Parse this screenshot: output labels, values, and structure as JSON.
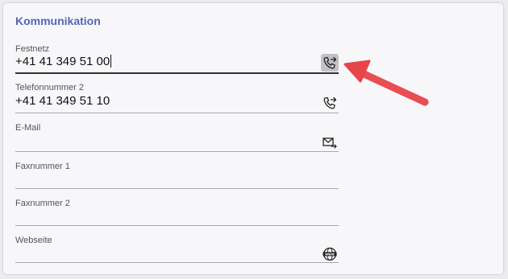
{
  "section": {
    "title": "Kommunikation"
  },
  "fields": {
    "festnetz": {
      "label": "Festnetz",
      "value": "+41 41 349 51 00",
      "icon": "phone-forward-icon"
    },
    "telefon2": {
      "label": "Telefonnummer 2",
      "value": "+41 41 349 51 10",
      "icon": "phone-forward-icon"
    },
    "email": {
      "label": "E-Mail",
      "value": "",
      "icon": "mail-send-icon"
    },
    "fax1": {
      "label": "Faxnummer 1",
      "value": ""
    },
    "fax2": {
      "label": "Faxnummer 2",
      "value": ""
    },
    "webseite": {
      "label": "Webseite",
      "value": "",
      "icon": "www-globe-icon"
    }
  },
  "colors": {
    "section_title": "#5266b0",
    "annotation_arrow": "#e8454a",
    "active_underline": "#333333"
  }
}
